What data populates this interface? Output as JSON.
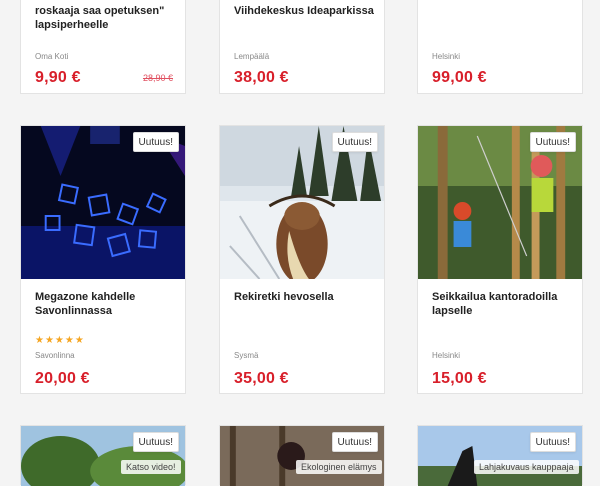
{
  "products": [
    {
      "title": "roskaaja saa opetuksen\" lapsiperheelle",
      "location": "Oma Koti",
      "price": "9,90 €",
      "old_price": "28,90 €"
    },
    {
      "title": "Viihdekeskus Ideaparkissa",
      "location": "Lempäälä",
      "price": "38,00 €"
    },
    {
      "title": "",
      "location": "Helsinki",
      "price": "99,00 €"
    },
    {
      "title": "Megazone kahdelle Savonlinnassa",
      "location": "Savonlinna",
      "price": "20,00 €",
      "badge": "Uutuus!",
      "rating": "★★★★★"
    },
    {
      "title": "Rekiretki hevosella",
      "location": "Sysmä",
      "price": "35,00 €",
      "badge": "Uutuus!"
    },
    {
      "title": "Seikkailua kantoradoilla lapselle",
      "location": "Helsinki",
      "price": "15,00 €",
      "badge": "Uutuus!"
    },
    {
      "badge": "Uutuus!",
      "overlay": "Katso video!"
    },
    {
      "badge": "Uutuus!",
      "overlay": "Ekologinen elämys"
    },
    {
      "badge": "Uutuus!",
      "overlay": "Lahjakuvaus kauppaaja"
    }
  ]
}
